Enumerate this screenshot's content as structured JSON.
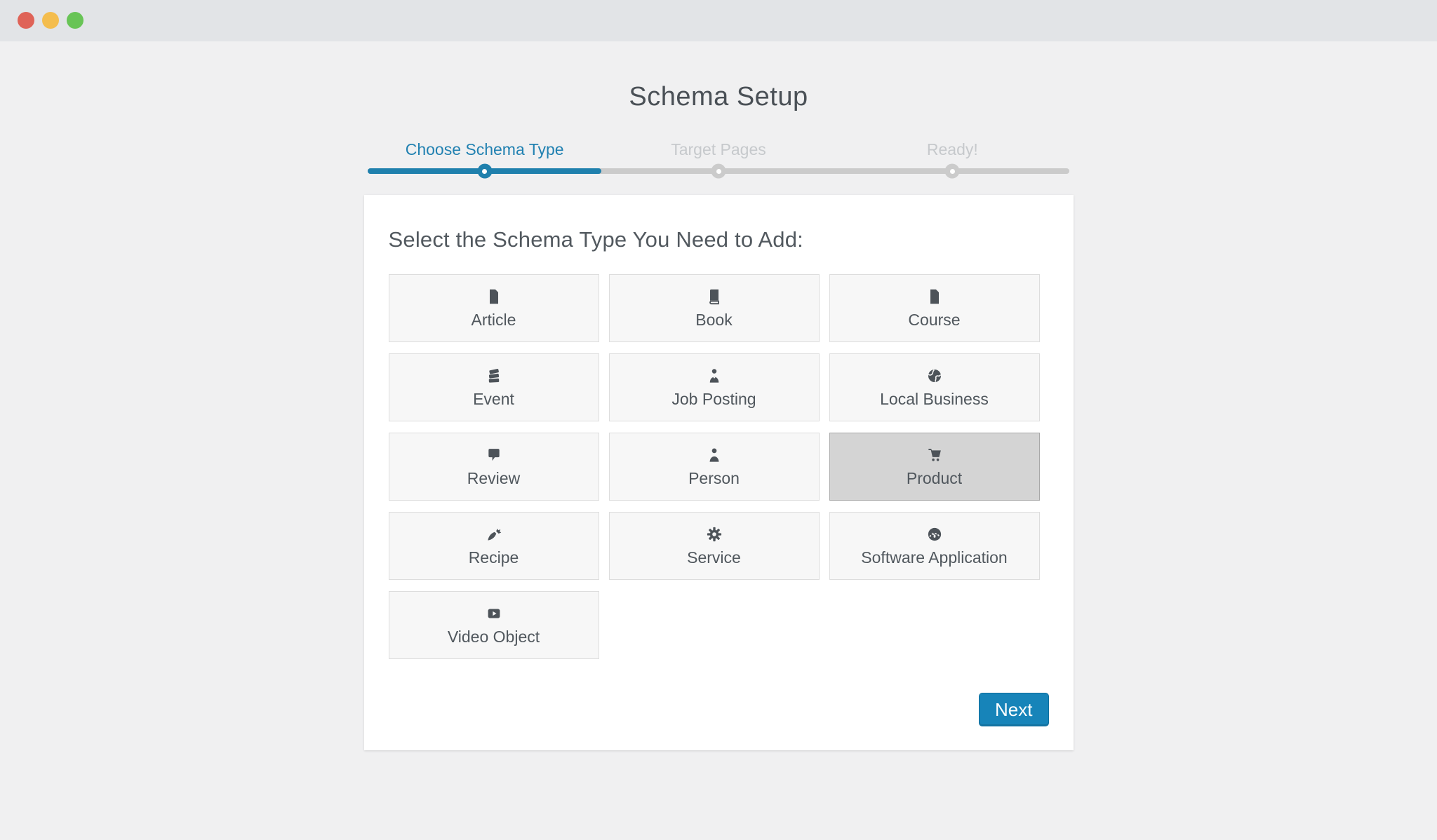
{
  "window": {
    "controls": [
      {
        "name": "close",
        "color": "#df6358"
      },
      {
        "name": "minimize",
        "color": "#f4bd4e"
      },
      {
        "name": "zoom",
        "color": "#68c456"
      }
    ]
  },
  "header": {
    "title": "Schema Setup"
  },
  "stepper": {
    "steps": [
      {
        "label": "Choose Schema Type",
        "state": "active"
      },
      {
        "label": "Target Pages",
        "state": "upcoming"
      },
      {
        "label": "Ready!",
        "state": "upcoming"
      }
    ],
    "progress_percent": 33
  },
  "main": {
    "heading": "Select the Schema Type You Need to Add:",
    "schema_types": [
      {
        "label": "Article",
        "icon": "article-icon",
        "selected": false
      },
      {
        "label": "Book",
        "icon": "book-icon",
        "selected": false
      },
      {
        "label": "Course",
        "icon": "course-icon",
        "selected": false
      },
      {
        "label": "Event",
        "icon": "tickets-icon",
        "selected": false
      },
      {
        "label": "Job Posting",
        "icon": "businessman-icon",
        "selected": false
      },
      {
        "label": "Local Business",
        "icon": "globe-icon",
        "selected": false
      },
      {
        "label": "Review",
        "icon": "comment-icon",
        "selected": false
      },
      {
        "label": "Person",
        "icon": "person-icon",
        "selected": false
      },
      {
        "label": "Product",
        "icon": "cart-icon",
        "selected": true
      },
      {
        "label": "Recipe",
        "icon": "carrot-icon",
        "selected": false
      },
      {
        "label": "Service",
        "icon": "gear-icon",
        "selected": false
      },
      {
        "label": "Software Application",
        "icon": "dashboard-icon",
        "selected": false
      },
      {
        "label": "Video Object",
        "icon": "video-icon",
        "selected": false
      }
    ],
    "next_button": "Next"
  },
  "colors": {
    "accent_blue": "#1f80ad",
    "active_step_blue": "#2181b1",
    "next_button_blue": "#1784b9",
    "selected_tile_gray": "#d4d4d4",
    "tile_background": "#f7f7f7",
    "inactive_step_gray": "#c6c9cc",
    "titlebar_gray": "#e2e4e7",
    "page_background": "#f0f0f1"
  }
}
